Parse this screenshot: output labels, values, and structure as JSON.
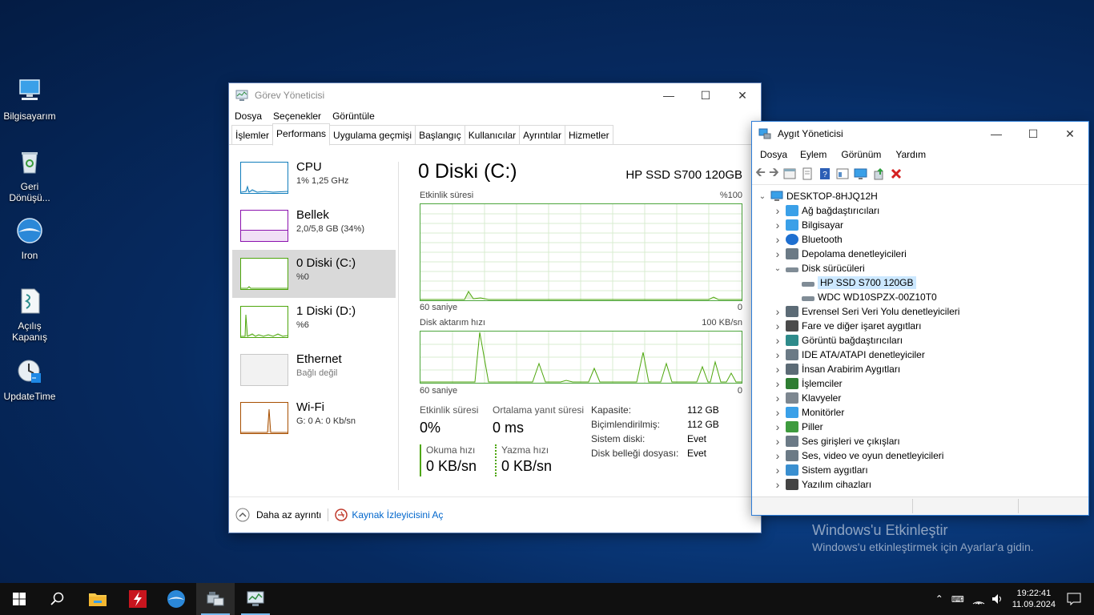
{
  "desktop": {
    "icons": [
      {
        "label": "Bilgisayarım"
      },
      {
        "label": "Geri Dönüşü..."
      },
      {
        "label": "Iron"
      },
      {
        "label": "Açılış Kapanış"
      },
      {
        "label": "UpdateTime"
      }
    ],
    "watermark": {
      "title": "Windows'u Etkinleştir",
      "subtitle": "Windows'u etkinleştirmek için Ayarlar'a gidin."
    }
  },
  "task_manager": {
    "title": "Görev Yöneticisi",
    "menu": [
      "Dosya",
      "Seçenekler",
      "Görüntüle"
    ],
    "tabs": [
      "İşlemler",
      "Performans",
      "Uygulama geçmişi",
      "Başlangıç",
      "Kullanıcılar",
      "Ayrıntılar",
      "Hizmetler"
    ],
    "active_tab": "Performans",
    "sidebar": [
      {
        "name": "CPU",
        "value": "1% 1,25 GHz",
        "color": "#117dbb"
      },
      {
        "name": "Bellek",
        "value": "2,0/5,8 GB (34%)",
        "color": "#8b12ae"
      },
      {
        "name": "0 Diski (C:)",
        "value": "%0",
        "color": "#4da60c",
        "selected": true
      },
      {
        "name": "1 Diski (D:)",
        "value": "%6",
        "color": "#4da60c"
      },
      {
        "name": "Ethernet",
        "value": "Bağlı değil",
        "color": "#a0a0a0"
      },
      {
        "name": "Wi-Fi",
        "value": "G: 0 A: 0 Kb/sn",
        "color": "#a74f01"
      }
    ],
    "detail": {
      "heading": "0 Diski (C:)",
      "model": "HP SSD S700 120GB",
      "graph1_label": "Etkinlik süresi",
      "graph1_max": "%100",
      "graph1_time": "60 saniye",
      "graph1_min": "0",
      "graph2_label": "Disk aktarım hızı",
      "graph2_max": "100 KB/sn",
      "graph2_time": "60 saniye",
      "graph2_min": "0",
      "active_time_label": "Etkinlik süresi",
      "active_time_value": "0%",
      "avg_response_label": "Ortalama yanıt süresi",
      "avg_response_value": "0 ms",
      "read_label": "Okuma hızı",
      "read_value": "0 KB/sn",
      "write_label": "Yazma hızı",
      "write_value": "0 KB/sn",
      "props": [
        {
          "k": "Kapasite:",
          "v": "112 GB"
        },
        {
          "k": "Biçimlendirilmiş:",
          "v": "112 GB"
        },
        {
          "k": "Sistem diski:",
          "v": "Evet"
        },
        {
          "k": "Disk belleği dosyası:",
          "v": "Evet"
        }
      ]
    },
    "footer": {
      "less_details": "Daha az ayrıntı",
      "resource_monitor": "Kaynak İzleyicisini Aç"
    }
  },
  "device_manager": {
    "title": "Aygıt Yöneticisi",
    "menu": [
      "Dosya",
      "Eylem",
      "Görünüm",
      "Yardım"
    ],
    "root": "DESKTOP-8HJQ12H",
    "nodes": [
      {
        "label": "Ağ bağdaştırıcıları",
        "icon": "network-icon"
      },
      {
        "label": "Bilgisayar",
        "icon": "computer-icon"
      },
      {
        "label": "Bluetooth",
        "icon": "bluetooth-icon"
      },
      {
        "label": "Depolama denetleyicileri",
        "icon": "storage-icon"
      },
      {
        "label": "Disk sürücüleri",
        "icon": "disk-icon",
        "expanded": true
      },
      {
        "label": "HP SSD S700 120GB",
        "icon": "disk-icon",
        "child": true,
        "selected": true
      },
      {
        "label": "WDC WD10SPZX-00Z10T0",
        "icon": "disk-icon",
        "child": true
      },
      {
        "label": "Evrensel Seri Veri Yolu denetleyicileri",
        "icon": "usb-icon"
      },
      {
        "label": "Fare ve diğer işaret aygıtları",
        "icon": "mouse-icon"
      },
      {
        "label": "Görüntü bağdaştırıcıları",
        "icon": "display-adapter-icon"
      },
      {
        "label": "IDE ATA/ATAPI denetleyiciler",
        "icon": "ide-icon"
      },
      {
        "label": "İnsan Arabirim Aygıtları",
        "icon": "hid-icon"
      },
      {
        "label": "İşlemciler",
        "icon": "processor-icon"
      },
      {
        "label": "Klavyeler",
        "icon": "keyboard-icon"
      },
      {
        "label": "Monitörler",
        "icon": "monitor-icon"
      },
      {
        "label": "Piller",
        "icon": "battery-icon"
      },
      {
        "label": "Ses girişleri ve çıkışları",
        "icon": "audio-icon"
      },
      {
        "label": "Ses, video ve oyun denetleyicileri",
        "icon": "sound-icon"
      },
      {
        "label": "Sistem aygıtları",
        "icon": "system-icon"
      },
      {
        "label": "Yazılım cihazları",
        "icon": "software-device-icon"
      }
    ]
  },
  "taskbar": {
    "time": "19:22:41",
    "date": "11.09.2024"
  }
}
